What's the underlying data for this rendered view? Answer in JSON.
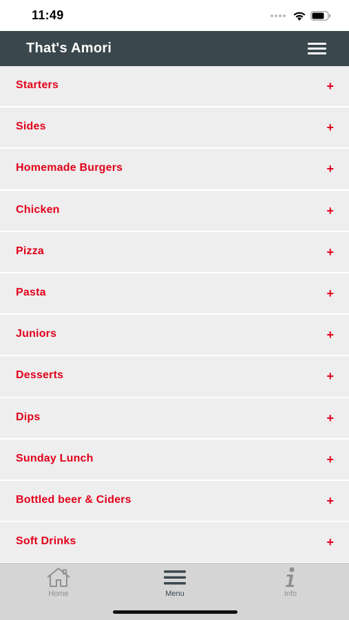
{
  "status_bar": {
    "time": "11:49"
  },
  "header": {
    "title": "That's Amori"
  },
  "menu": {
    "items": [
      {
        "label": "Starters",
        "icon": "+"
      },
      {
        "label": "Sides",
        "icon": "+"
      },
      {
        "label": "Homemade Burgers",
        "icon": "+"
      },
      {
        "label": "Chicken",
        "icon": "+"
      },
      {
        "label": "Pizza",
        "icon": "+"
      },
      {
        "label": "Pasta",
        "icon": "+"
      },
      {
        "label": "Juniors",
        "icon": "+"
      },
      {
        "label": "Desserts",
        "icon": "+"
      },
      {
        "label": "Dips",
        "icon": "+"
      },
      {
        "label": "Sunday Lunch",
        "icon": "+"
      },
      {
        "label": "Bottled beer & Ciders",
        "icon": "+"
      },
      {
        "label": "Soft Drinks",
        "icon": "+"
      }
    ]
  },
  "tab_bar": {
    "home": {
      "label": "Home",
      "icon": "home-icon",
      "color": "#8f8f8f"
    },
    "menu": {
      "label": "Menu",
      "icon": "hamburger-icon",
      "color": "#3a474d",
      "active": true
    },
    "info": {
      "label": "Info",
      "icon": "info-icon",
      "color": "#8f8f8f"
    }
  },
  "colors": {
    "header_bg": "#3a474d",
    "accent_red": "#e2001a",
    "row_bg": "#eeeeee",
    "tab_bar_bg": "#d5d5d5"
  }
}
